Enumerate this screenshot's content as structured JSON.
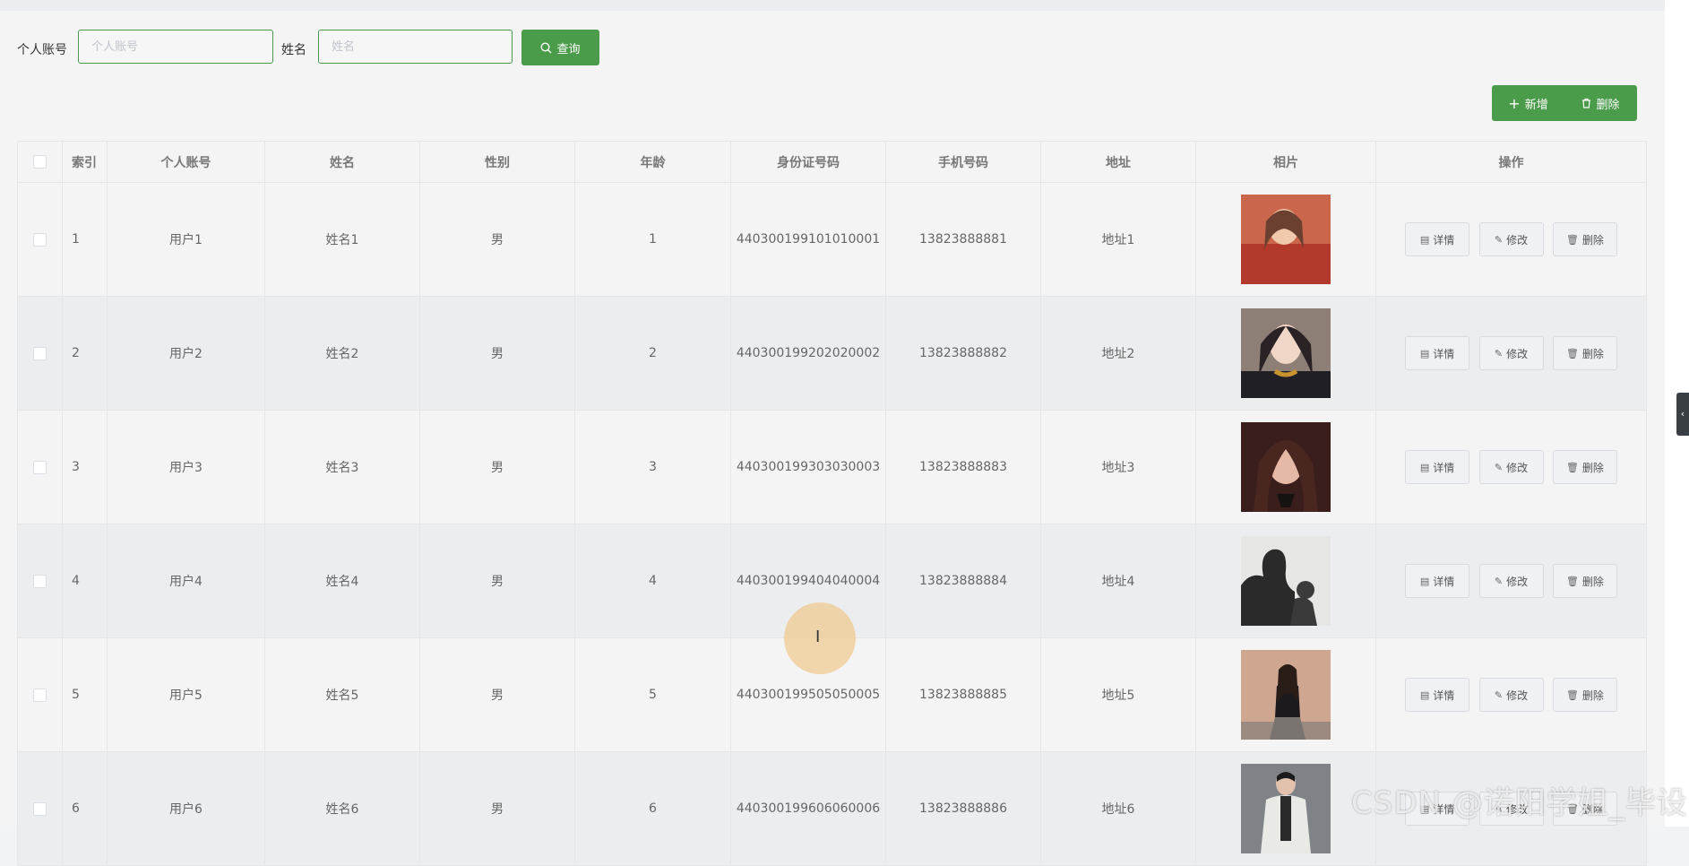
{
  "search": {
    "account_label": "个人账号",
    "account_placeholder": "个人账号",
    "name_label": "姓名",
    "name_placeholder": "姓名",
    "query_button": "查询"
  },
  "toolbar": {
    "add_button": "新增",
    "delete_button": "删除"
  },
  "table": {
    "columns": [
      "索引",
      "个人账号",
      "姓名",
      "性别",
      "年龄",
      "身份证号码",
      "手机号码",
      "地址",
      "相片",
      "操作"
    ],
    "rows": [
      {
        "index": "1",
        "account": "用户1",
        "name": "姓名1",
        "gender": "男",
        "age": "1",
        "id_number": "440300199101010001",
        "phone": "13823888881",
        "address": "地址1"
      },
      {
        "index": "2",
        "account": "用户2",
        "name": "姓名2",
        "gender": "男",
        "age": "2",
        "id_number": "440300199202020002",
        "phone": "13823888882",
        "address": "地址2"
      },
      {
        "index": "3",
        "account": "用户3",
        "name": "姓名3",
        "gender": "男",
        "age": "3",
        "id_number": "440300199303030003",
        "phone": "13823888883",
        "address": "地址3"
      },
      {
        "index": "4",
        "account": "用户4",
        "name": "姓名4",
        "gender": "男",
        "age": "4",
        "id_number": "440300199404040004",
        "phone": "13823888884",
        "address": "地址4"
      },
      {
        "index": "5",
        "account": "用户5",
        "name": "姓名5",
        "gender": "男",
        "age": "5",
        "id_number": "440300199505050005",
        "phone": "13823888885",
        "address": "地址5"
      },
      {
        "index": "6",
        "account": "用户6",
        "name": "姓名6",
        "gender": "男",
        "age": "6",
        "id_number": "440300199606060006",
        "phone": "13823888886",
        "address": "地址6"
      }
    ],
    "actions": {
      "detail": "详情",
      "edit": "修改",
      "delete": "删除"
    }
  },
  "watermark": "CSDN @诺阳学姐_毕设",
  "colors": {
    "primary": "#4a9b4a",
    "border": "#e6e6e6"
  }
}
